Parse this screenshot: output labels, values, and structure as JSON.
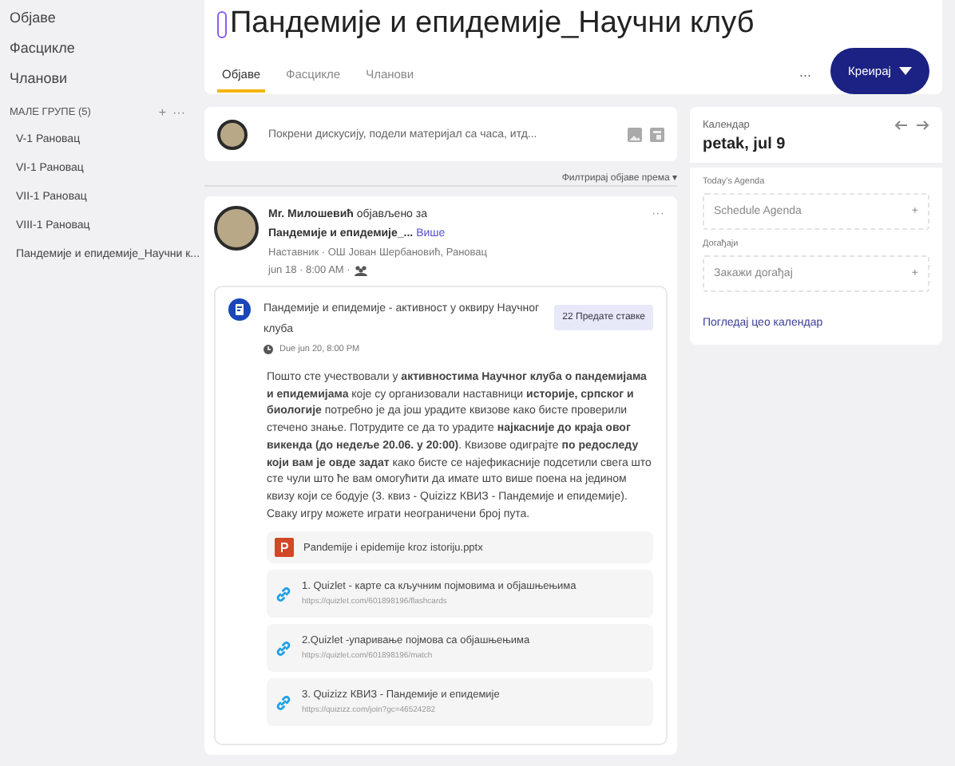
{
  "sidebar": {
    "items": [
      {
        "label": "Објаве"
      },
      {
        "label": "Фасцикле"
      },
      {
        "label": "Чланови"
      }
    ],
    "small_groups": {
      "title": "МАЛЕ ГРУПЕ (5)",
      "add": "+",
      "more": "···",
      "items": [
        {
          "label": "V-1 Рановац"
        },
        {
          "label": "VI-1 Рановац"
        },
        {
          "label": "VII-1 Рановац"
        },
        {
          "label": "VIII-1 Рановац"
        },
        {
          "label": "Пандемије и епидемије_Научни к..."
        }
      ]
    }
  },
  "header": {
    "title": "Пандемије и епидемије_Научни клуб",
    "more": "...",
    "create_button": "Креирај",
    "tabs": [
      {
        "label": "Објаве",
        "selected": true
      },
      {
        "label": "Фасцикле",
        "selected": false
      },
      {
        "label": "Чланови",
        "selected": false
      }
    ]
  },
  "composer": {
    "placeholder": "Покрени дискусију, подели материјал са часа, итд..."
  },
  "filter": "Филтрирај објаве према",
  "filter_caret": "▾",
  "post": {
    "author_line": "**Мr. Милошевић** објављено за",
    "group": "Пандемије и епидемије_...",
    "more_link": "Више",
    "role": "Наставник · ОШ Јован Шербановић, Рановац",
    "time": "jun 18 · 8:00 AM ·",
    "menu": "···",
    "assignment": {
      "title": "Пандемије и епидемије - активност у оквиру Научног клуба",
      "submitted": "22 Предате ставке",
      "due": "Due jun 20, 8:00 PM",
      "body": "Пошто сте учествовали у **активностима Научног клуба о пандемијама и епидемијама** које су организовали наставници **историје, српског и биологије** потребно је да још урадите квизове како бисте проверили стечено знање. Потрудите се да то урадите **најкасније до краја овог викенда (до недеље 20.06. у 20:00)**. Квизове одиграјте **по редоследу који вам је овде задат** како бисте се најефикасније подсетили свега што сте чули што ће вам омогућити да имате што више поена на јединoм квизу који се бодује (3. квиз - Quizizz КВИЗ - Пандемије и епидемије). Сваку игру можете играти неограничени број пута.",
      "attachments": [
        {
          "kind": "file",
          "title": "Pandemije i epidemije kroz istoriju.pptx"
        },
        {
          "kind": "link",
          "title": "1. Quizlet - карте са кључним појмовима и објашњењима",
          "url": "https://quizlet.com/601898196/flashcards"
        },
        {
          "kind": "link",
          "title": "2.Quizlet -упаривање појмова са објашњењима",
          "url": "https://quizlet.com/601898196/match"
        },
        {
          "kind": "link",
          "title": "3. Quizizz КВИЗ - Пандемије и епидемије",
          "url": "https://quizizz.com/join?gc=46524282"
        }
      ]
    }
  },
  "calendar": {
    "label": "Календар",
    "date": "petak, jul 9",
    "agenda_label": "Today's Agenda",
    "agenda_action": "Schedule Agenda",
    "add": "+",
    "events_label": "Догађаји",
    "events_action": "Закажи догађај",
    "view_all": "Погледај цео календар"
  }
}
